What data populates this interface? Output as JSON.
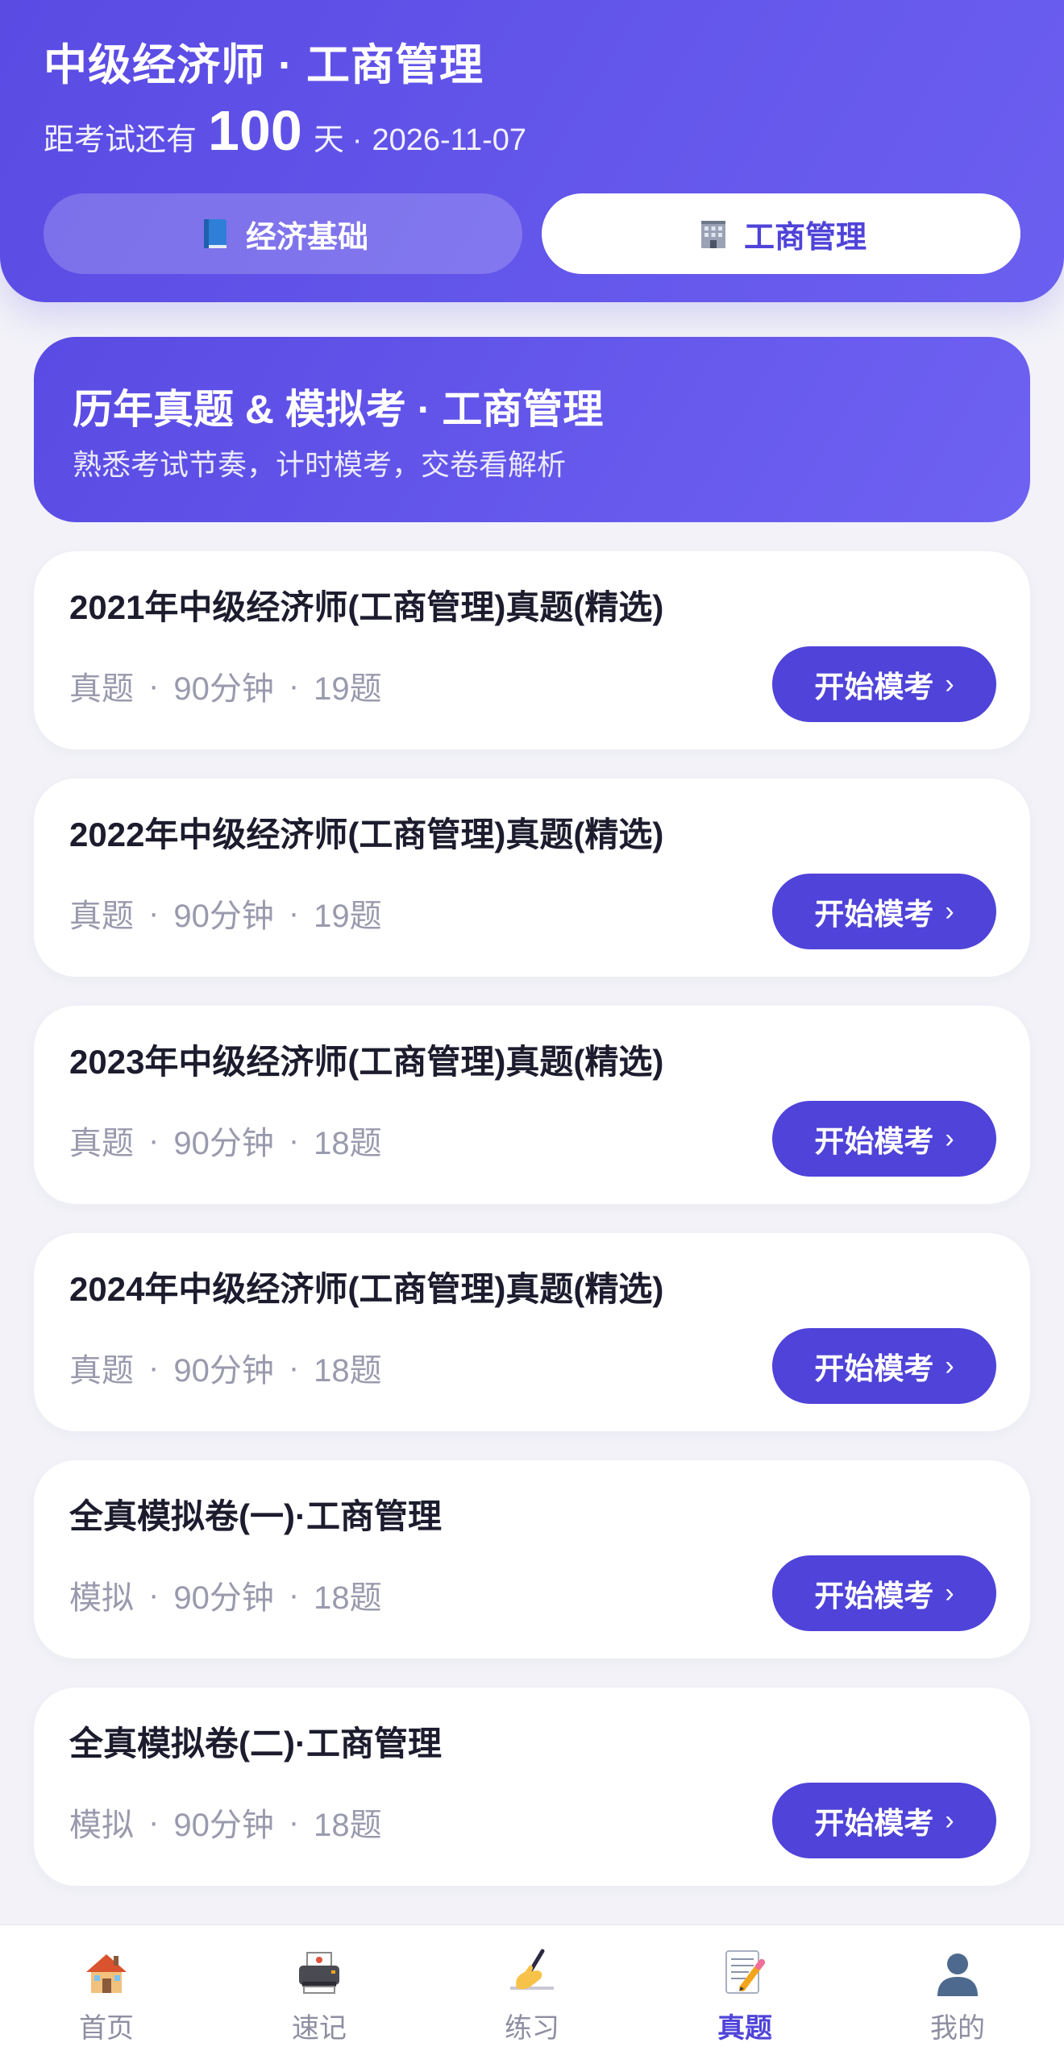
{
  "header": {
    "title": "中级经济师 · 工商管理",
    "countdown_prefix": "距考试还有",
    "countdown_days": "100",
    "countdown_unit": "天",
    "countdown_sep": "·",
    "exam_date": "2026-11-07"
  },
  "subject_tabs": [
    {
      "label": "经济基础",
      "icon": "book-icon",
      "active": false
    },
    {
      "label": "工商管理",
      "icon": "office-building-icon",
      "active": true
    }
  ],
  "banner": {
    "title": "历年真题 & 模拟考 · 工商管理",
    "subtitle": "熟悉考试节奏，计时模考，交卷看解析"
  },
  "exam_list": [
    {
      "title": "2021年中级经济师(工商管理)真题(精选)",
      "type": "真题",
      "duration": "90分钟",
      "count": "19题",
      "button": "开始模考"
    },
    {
      "title": "2022年中级经济师(工商管理)真题(精选)",
      "type": "真题",
      "duration": "90分钟",
      "count": "19题",
      "button": "开始模考"
    },
    {
      "title": "2023年中级经济师(工商管理)真题(精选)",
      "type": "真题",
      "duration": "90分钟",
      "count": "18题",
      "button": "开始模考"
    },
    {
      "title": "2024年中级经济师(工商管理)真题(精选)",
      "type": "真题",
      "duration": "90分钟",
      "count": "18题",
      "button": "开始模考"
    },
    {
      "title": "全真模拟卷(一)·工商管理",
      "type": "模拟",
      "duration": "90分钟",
      "count": "18题",
      "button": "开始模考"
    },
    {
      "title": "全真模拟卷(二)·工商管理",
      "type": "模拟",
      "duration": "90分钟",
      "count": "18题",
      "button": "开始模考"
    }
  ],
  "meta_separator": "·",
  "button_chevron": "›",
  "bottom_nav": [
    {
      "label": "首页",
      "icon": "house-icon",
      "active": false
    },
    {
      "label": "速记",
      "icon": "printer-icon",
      "active": false
    },
    {
      "label": "练习",
      "icon": "writing-hand-icon",
      "active": false
    },
    {
      "label": "真题",
      "icon": "memo-pencil-icon",
      "active": true
    },
    {
      "label": "我的",
      "icon": "user-silhouette-icon",
      "active": false
    }
  ],
  "colors": {
    "primary": "#4f43d9",
    "header_gradient_start": "#5a4be3",
    "header_gradient_end": "#6b5ff0",
    "background": "#f2f2f8",
    "muted_text": "#9a9aae"
  }
}
